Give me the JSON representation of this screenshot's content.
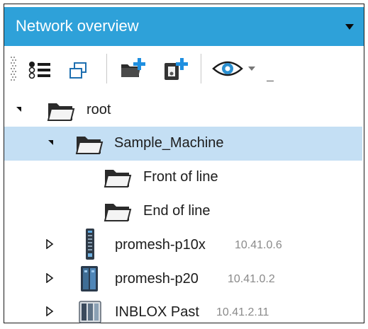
{
  "panel": {
    "title": "Network overview",
    "dropdown_icon": "chevron-down-icon",
    "accent_color": "#2ea1d9"
  },
  "toolbar": {
    "icons": [
      "grip-icon",
      "list-view-icon",
      "copy-windows-icon",
      "add-folder-icon",
      "add-device-icon",
      "eye-view-icon",
      "dropdown-arrow-icon"
    ],
    "eye_color": "#2a8fd0"
  },
  "tree": {
    "selection_color": "#c4dff4",
    "root": {
      "label": "root",
      "expanded": true
    },
    "sample_machine": {
      "label": "Sample_Machine",
      "expanded": true,
      "selected": true
    },
    "front_of_line": {
      "label": "Front of line"
    },
    "end_of_line": {
      "label": "End of line"
    },
    "devices": [
      {
        "name": "promesh-p10x",
        "ip": "10.41.0.6"
      },
      {
        "name": "promesh-p20",
        "ip": "10.41.0.2"
      },
      {
        "name": "INBLOX Past",
        "ip": "10.41.2.11"
      }
    ]
  }
}
